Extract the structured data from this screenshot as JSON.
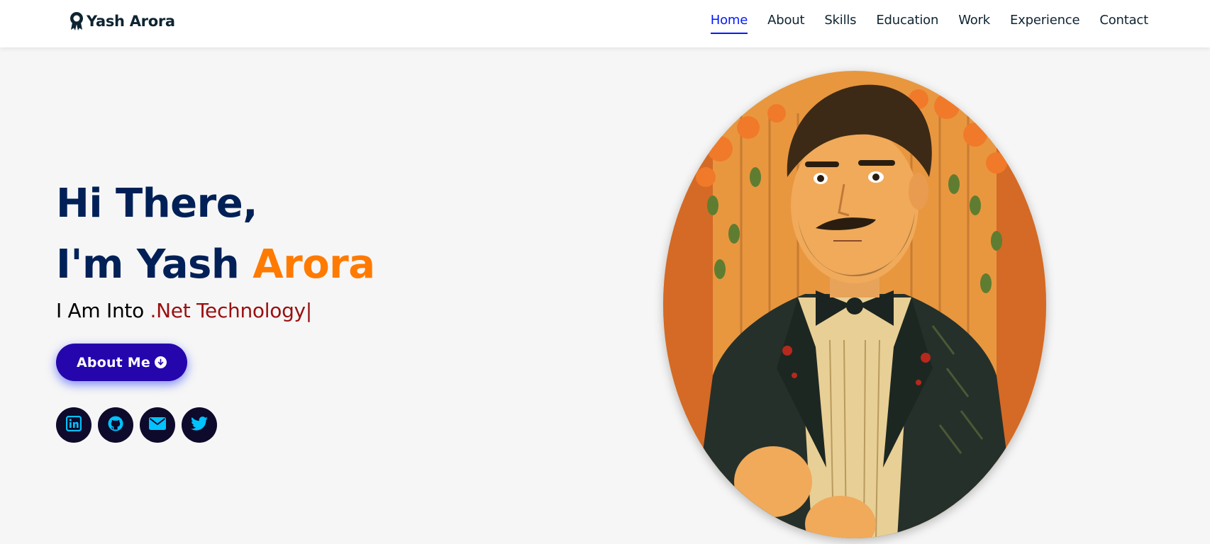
{
  "header": {
    "brand": "Yash Arora",
    "nav": [
      {
        "label": "Home",
        "active": true
      },
      {
        "label": "About"
      },
      {
        "label": "Skills"
      },
      {
        "label": "Education"
      },
      {
        "label": "Work"
      },
      {
        "label": "Experience"
      },
      {
        "label": "Contact"
      }
    ]
  },
  "hero": {
    "greeting": "Hi There,",
    "name_prefix": "I'm Yash ",
    "name_accent": "Arora",
    "typing_prefix": "I Am Into ",
    "typing_text": ".Net Technology|",
    "button_label": "About Me",
    "socials": [
      {
        "icon": "linkedin-icon"
      },
      {
        "icon": "github-icon"
      },
      {
        "icon": "envelope-icon"
      },
      {
        "icon": "twitter-icon"
      }
    ]
  },
  "colors": {
    "navy": "#002057",
    "accent_orange": "#ff7a00",
    "nav_active": "#011aff",
    "typed_red": "#991010",
    "button": "#2506ad",
    "social_bg": "#0e0a2b",
    "social_icon": "#00c3ff",
    "page_bg": "#f6f6f6"
  }
}
